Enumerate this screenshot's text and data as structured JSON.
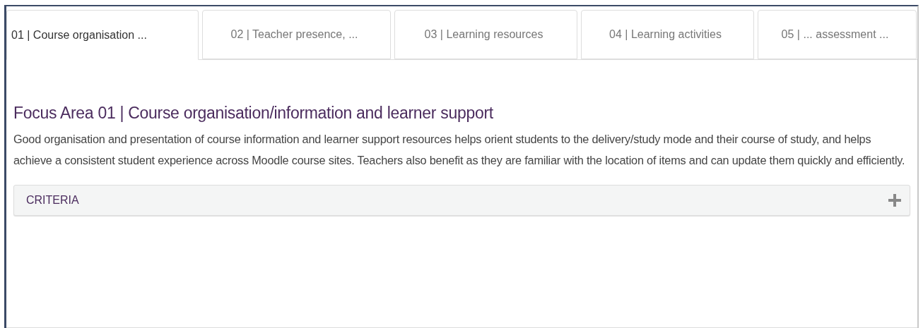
{
  "tabs": [
    {
      "label": "01 | Course organisation ...",
      "selected": true
    },
    {
      "label": "02 | Teacher presence, ...",
      "selected": false
    },
    {
      "label": "03 | Learning resources",
      "selected": false
    },
    {
      "label": "04 | Learning activities",
      "selected": false
    },
    {
      "label": "05 | ... assessment ...",
      "selected": false
    }
  ],
  "heading": "Focus Area 01 | Course organisation/information and learner support",
  "description": "Good organisation and presentation of course information and learner support resources helps orient students to the delivery/study mode and their course of study, and helps achieve a consistent student experience across Moodle course sites. Teachers also benefit as they are familiar with the location of items and can update them quickly and efficiently.",
  "accordion": {
    "title": "CRITERIA",
    "expanded": false
  }
}
